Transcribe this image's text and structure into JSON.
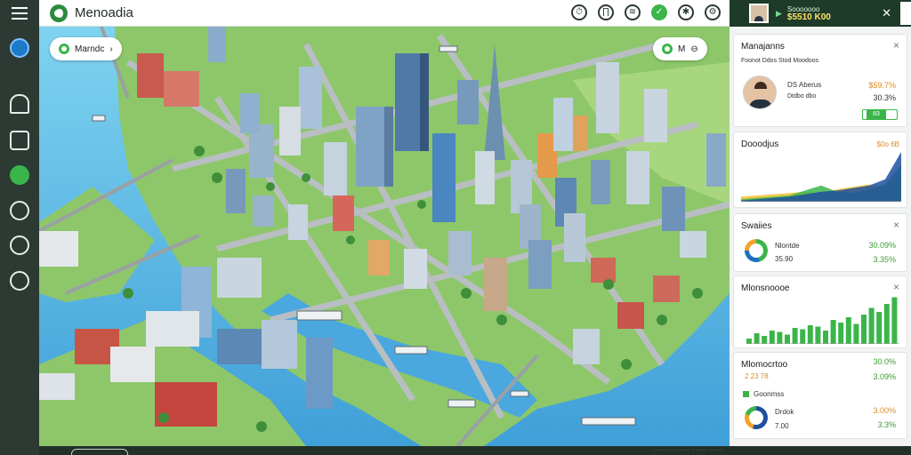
{
  "app": {
    "title": "Menoadia"
  },
  "toolbar": {
    "icons": [
      "notifications-icon",
      "pin-icon",
      "layers-icon",
      "eco-icon",
      "compass-icon",
      "settings-icon"
    ],
    "icon_glyphs": [
      "⏱",
      "∏",
      "≋",
      "✓",
      "✱",
      "⚙"
    ]
  },
  "account": {
    "line1": "Sooooooo",
    "balance": "$5510 K00"
  },
  "sidebar": {
    "items": [
      {
        "name": "home-icon",
        "glyph": "⊙"
      },
      {
        "name": "build-icon",
        "glyph": "⋂"
      },
      {
        "name": "map-icon",
        "glyph": "▥"
      },
      {
        "name": "eco-icon",
        "glyph": "⚡"
      },
      {
        "name": "people-icon",
        "glyph": "⚇"
      },
      {
        "name": "help-icon",
        "glyph": "?"
      },
      {
        "name": "chat-icon",
        "glyph": "✎"
      }
    ]
  },
  "map": {
    "zone_pill": "Marndc",
    "zone_chevron": "›",
    "control_pill": "M",
    "control_toggle": "⊖"
  },
  "panel": {
    "managers": {
      "title": "Manajanns",
      "subtitle": "Foonot Ddos Stod Moodoos",
      "name": "DS Aberus",
      "role": "Dtdbo dbo",
      "value1": "$59.7%",
      "value2": "30.3%",
      "button": "83"
    },
    "growth": {
      "title": "Dooodjus",
      "value": "$0o 6B"
    },
    "services": {
      "title": "Swaiies",
      "label1": "Nlontde",
      "label2": "35.90",
      "value1": "30.09%",
      "value2": "3.35%"
    },
    "monitor": {
      "title": "Mlonsnoooe"
    },
    "summary": {
      "title": "Mlomocrtoo",
      "value_a": "30.0%",
      "row1_label": "2 23 78",
      "row1_value": "3.09%",
      "legend_label": "Goonmss",
      "row2_label": "Drdok",
      "row2_sub": "7.00",
      "row2_value": "3.00%",
      "row2_value_b": "3.3%"
    }
  },
  "colors": {
    "accent": "#3bb54a",
    "dark": "#2c3a33",
    "warn": "#e08b1a"
  },
  "chart_data": [
    {
      "type": "area",
      "title": "Dooodjus",
      "x": [
        0,
        1,
        2,
        3,
        4,
        5,
        6,
        7,
        8,
        9,
        10
      ],
      "series": [
        {
          "values": [
            4,
            5,
            6,
            7,
            8,
            6,
            10,
            12,
            14,
            10,
            22
          ]
        },
        {
          "values": [
            2,
            3,
            4,
            5,
            9,
            13,
            8,
            7,
            10,
            14,
            30
          ]
        },
        {
          "values": [
            1,
            2,
            3,
            4,
            6,
            8,
            9,
            11,
            13,
            18,
            40
          ]
        }
      ],
      "ylim": [
        0,
        40
      ]
    },
    {
      "type": "bar",
      "title": "Mlonsnoooe",
      "categories": [
        "1",
        "2",
        "3",
        "4",
        "5",
        "6",
        "7",
        "8",
        "9",
        "10",
        "11",
        "12",
        "13",
        "14",
        "15",
        "16",
        "17",
        "18",
        "19",
        "20"
      ],
      "values": [
        4,
        8,
        6,
        10,
        9,
        7,
        12,
        11,
        14,
        13,
        10,
        18,
        16,
        20,
        15,
        22,
        27,
        24,
        30,
        35
      ],
      "ylim": [
        0,
        36
      ]
    }
  ]
}
